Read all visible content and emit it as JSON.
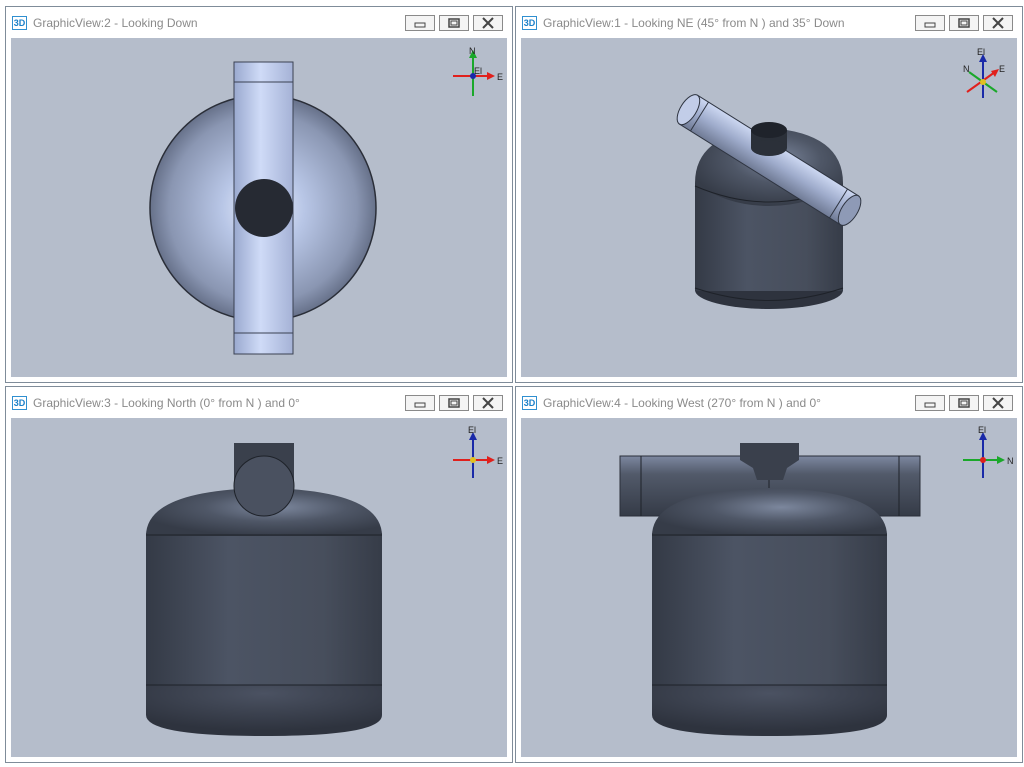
{
  "views": [
    {
      "id": "view2",
      "badge": "3D",
      "title": "GraphicView:2 - Looking Down",
      "axis": {
        "up": "N",
        "right": "E",
        "center": "El"
      }
    },
    {
      "id": "view1",
      "badge": "3D",
      "title": "GraphicView:1 - Looking NE (45° from N ) and 35° Down",
      "axis": {
        "up": "El",
        "left": "N",
        "right": "E"
      }
    },
    {
      "id": "view3",
      "badge": "3D",
      "title": "GraphicView:3 - Looking North (0° from N ) and 0°",
      "axis": {
        "up": "El",
        "right": "E"
      }
    },
    {
      "id": "view4",
      "badge": "3D",
      "title": "GraphicView:4 - Looking West (270° from N ) and 0°",
      "axis": {
        "up": "El",
        "right": "N"
      }
    }
  ],
  "colors": {
    "viewport_bg": "#b5bdcb",
    "vessel_dark": "#454c5a",
    "vessel_light": "#c9d6f2",
    "axis_red": "#e0201c",
    "axis_green": "#1aa82a",
    "axis_blue": "#1a2aa8"
  }
}
